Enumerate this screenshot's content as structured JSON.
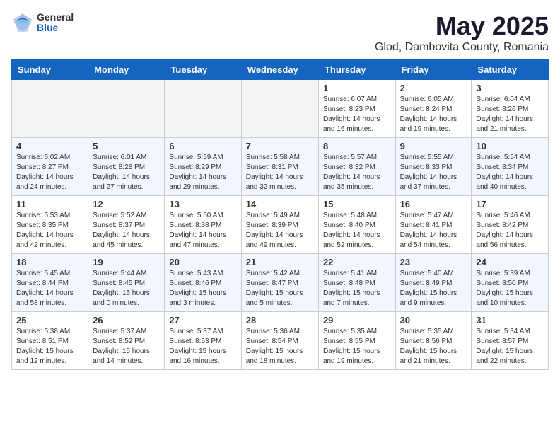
{
  "header": {
    "logo_general": "General",
    "logo_blue": "Blue",
    "title": "May 2025",
    "subtitle": "Glod, Dambovita County, Romania"
  },
  "days_of_week": [
    "Sunday",
    "Monday",
    "Tuesday",
    "Wednesday",
    "Thursday",
    "Friday",
    "Saturday"
  ],
  "weeks": [
    [
      {
        "day": "",
        "info": ""
      },
      {
        "day": "",
        "info": ""
      },
      {
        "day": "",
        "info": ""
      },
      {
        "day": "",
        "info": ""
      },
      {
        "day": "1",
        "info": "Sunrise: 6:07 AM\nSunset: 8:23 PM\nDaylight: 14 hours\nand 16 minutes."
      },
      {
        "day": "2",
        "info": "Sunrise: 6:05 AM\nSunset: 8:24 PM\nDaylight: 14 hours\nand 19 minutes."
      },
      {
        "day": "3",
        "info": "Sunrise: 6:04 AM\nSunset: 8:26 PM\nDaylight: 14 hours\nand 21 minutes."
      }
    ],
    [
      {
        "day": "4",
        "info": "Sunrise: 6:02 AM\nSunset: 8:27 PM\nDaylight: 14 hours\nand 24 minutes."
      },
      {
        "day": "5",
        "info": "Sunrise: 6:01 AM\nSunset: 8:28 PM\nDaylight: 14 hours\nand 27 minutes."
      },
      {
        "day": "6",
        "info": "Sunrise: 5:59 AM\nSunset: 8:29 PM\nDaylight: 14 hours\nand 29 minutes."
      },
      {
        "day": "7",
        "info": "Sunrise: 5:58 AM\nSunset: 8:31 PM\nDaylight: 14 hours\nand 32 minutes."
      },
      {
        "day": "8",
        "info": "Sunrise: 5:57 AM\nSunset: 8:32 PM\nDaylight: 14 hours\nand 35 minutes."
      },
      {
        "day": "9",
        "info": "Sunrise: 5:55 AM\nSunset: 8:33 PM\nDaylight: 14 hours\nand 37 minutes."
      },
      {
        "day": "10",
        "info": "Sunrise: 5:54 AM\nSunset: 8:34 PM\nDaylight: 14 hours\nand 40 minutes."
      }
    ],
    [
      {
        "day": "11",
        "info": "Sunrise: 5:53 AM\nSunset: 8:35 PM\nDaylight: 14 hours\nand 42 minutes."
      },
      {
        "day": "12",
        "info": "Sunrise: 5:52 AM\nSunset: 8:37 PM\nDaylight: 14 hours\nand 45 minutes."
      },
      {
        "day": "13",
        "info": "Sunrise: 5:50 AM\nSunset: 8:38 PM\nDaylight: 14 hours\nand 47 minutes."
      },
      {
        "day": "14",
        "info": "Sunrise: 5:49 AM\nSunset: 8:39 PM\nDaylight: 14 hours\nand 49 minutes."
      },
      {
        "day": "15",
        "info": "Sunrise: 5:48 AM\nSunset: 8:40 PM\nDaylight: 14 hours\nand 52 minutes."
      },
      {
        "day": "16",
        "info": "Sunrise: 5:47 AM\nSunset: 8:41 PM\nDaylight: 14 hours\nand 54 minutes."
      },
      {
        "day": "17",
        "info": "Sunrise: 5:46 AM\nSunset: 8:42 PM\nDaylight: 14 hours\nand 56 minutes."
      }
    ],
    [
      {
        "day": "18",
        "info": "Sunrise: 5:45 AM\nSunset: 8:44 PM\nDaylight: 14 hours\nand 58 minutes."
      },
      {
        "day": "19",
        "info": "Sunrise: 5:44 AM\nSunset: 8:45 PM\nDaylight: 15 hours\nand 0 minutes."
      },
      {
        "day": "20",
        "info": "Sunrise: 5:43 AM\nSunset: 8:46 PM\nDaylight: 15 hours\nand 3 minutes."
      },
      {
        "day": "21",
        "info": "Sunrise: 5:42 AM\nSunset: 8:47 PM\nDaylight: 15 hours\nand 5 minutes."
      },
      {
        "day": "22",
        "info": "Sunrise: 5:41 AM\nSunset: 8:48 PM\nDaylight: 15 hours\nand 7 minutes."
      },
      {
        "day": "23",
        "info": "Sunrise: 5:40 AM\nSunset: 8:49 PM\nDaylight: 15 hours\nand 9 minutes."
      },
      {
        "day": "24",
        "info": "Sunrise: 5:39 AM\nSunset: 8:50 PM\nDaylight: 15 hours\nand 10 minutes."
      }
    ],
    [
      {
        "day": "25",
        "info": "Sunrise: 5:38 AM\nSunset: 8:51 PM\nDaylight: 15 hours\nand 12 minutes."
      },
      {
        "day": "26",
        "info": "Sunrise: 5:37 AM\nSunset: 8:52 PM\nDaylight: 15 hours\nand 14 minutes."
      },
      {
        "day": "27",
        "info": "Sunrise: 5:37 AM\nSunset: 8:53 PM\nDaylight: 15 hours\nand 16 minutes."
      },
      {
        "day": "28",
        "info": "Sunrise: 5:36 AM\nSunset: 8:54 PM\nDaylight: 15 hours\nand 18 minutes."
      },
      {
        "day": "29",
        "info": "Sunrise: 5:35 AM\nSunset: 8:55 PM\nDaylight: 15 hours\nand 19 minutes."
      },
      {
        "day": "30",
        "info": "Sunrise: 5:35 AM\nSunset: 8:56 PM\nDaylight: 15 hours\nand 21 minutes."
      },
      {
        "day": "31",
        "info": "Sunrise: 5:34 AM\nSunset: 8:57 PM\nDaylight: 15 hours\nand 22 minutes."
      }
    ]
  ]
}
